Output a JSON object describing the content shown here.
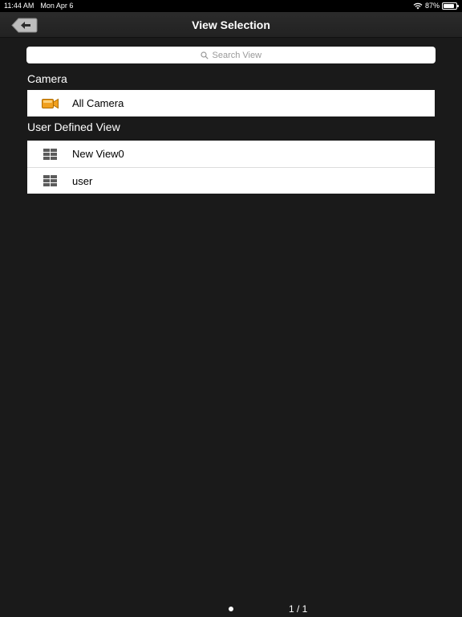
{
  "status": {
    "time": "11:44 AM",
    "date": "Mon Apr 6",
    "battery": "87%",
    "battery_level": 0.87
  },
  "nav": {
    "title": "View Selection",
    "back_icon": "back-arrow-icon"
  },
  "search": {
    "placeholder": "Search View",
    "value": ""
  },
  "camera_section": {
    "header": "Camera",
    "items": [
      {
        "label": "All Camera",
        "icon": "camera-icon"
      }
    ]
  },
  "user_section": {
    "header": "User Defined View",
    "items": [
      {
        "label": "New View0",
        "icon": "grid-layout-icon"
      },
      {
        "label": "user",
        "icon": "grid-layout-icon"
      }
    ]
  },
  "pager": {
    "page_text": "1 / 1"
  },
  "colors": {
    "camera_orange": "#f0a020",
    "background": "#1a1a1a"
  }
}
